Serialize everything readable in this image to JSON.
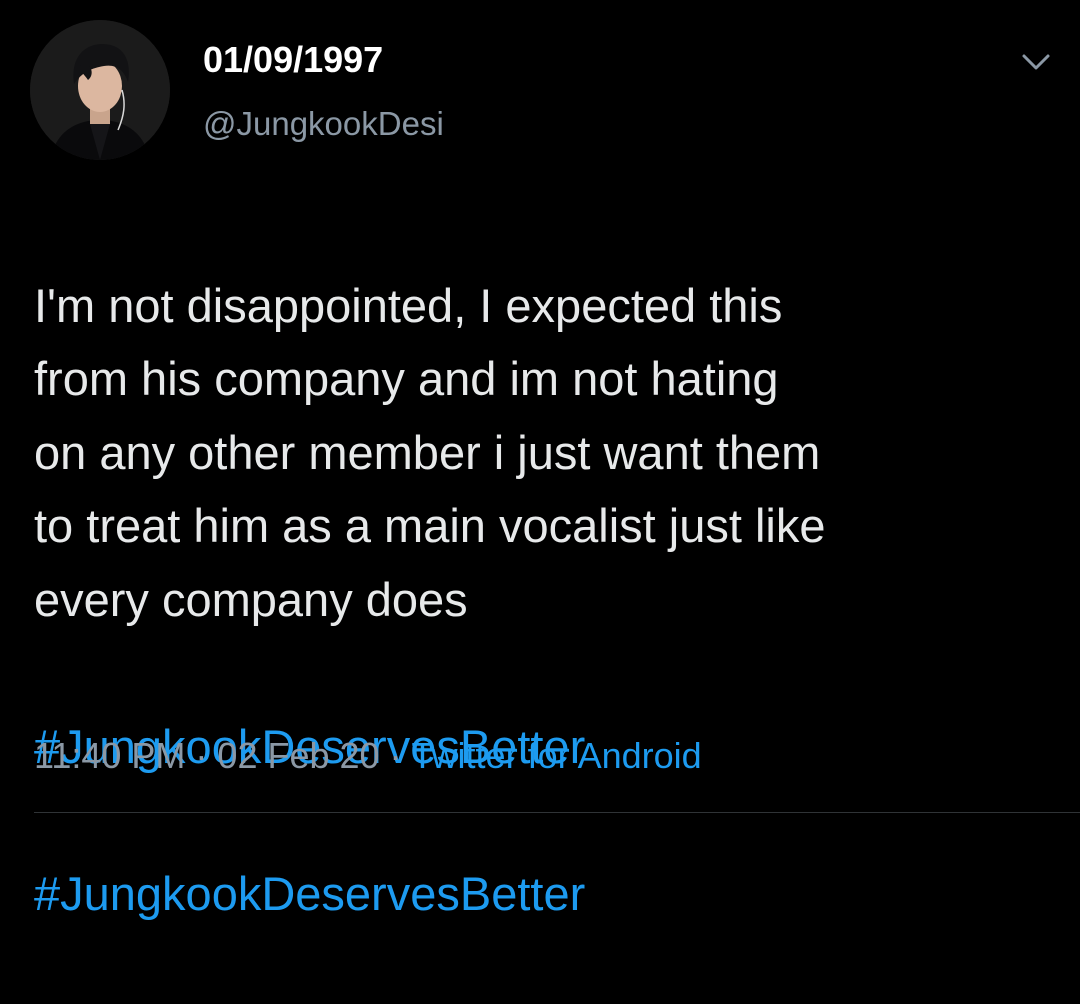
{
  "tweet": {
    "author": {
      "display_name": "01/09/1997",
      "handle": "@JungkookDesi"
    },
    "body": "I'm not disappointed, I expected this\nfrom his company and im not hating\non any other member i just want them\nto treat him as a main vocalist just like\nevery company does",
    "hashtags": [
      "#JungkookDeservesBetter",
      "#JungkookDeservesBetter"
    ],
    "meta": {
      "time": "11:40 PM",
      "separator": "·",
      "date": "02 Feb 20",
      "source": "Twitter for Android"
    },
    "icons": {
      "menu": "chevron-down-icon",
      "avatar": "profile-photo"
    },
    "colors": {
      "background": "#000000",
      "link": "#1d9bf0",
      "secondary_text": "#8b98a5"
    }
  }
}
